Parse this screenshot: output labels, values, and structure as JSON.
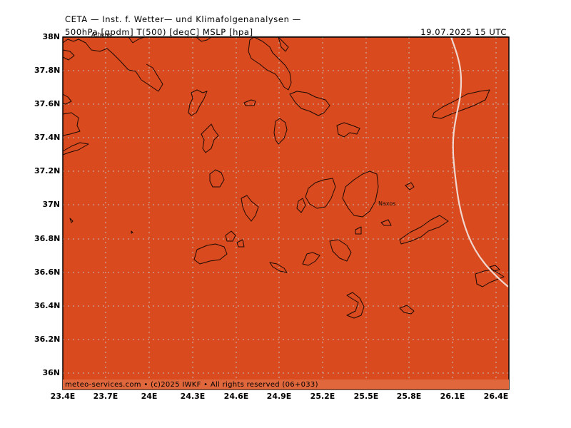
{
  "header": {
    "agency": "CETA — Inst. f. Wetter— und Klimafolgenanalysen —",
    "params": "500hPa [gpdm] T(500) [degC] MSLP [hpa]",
    "datetime": "19.07.2025 15 UTC"
  },
  "map": {
    "fill_color": "#d94a1e",
    "coast_color": "#1a0a05",
    "isoline_color": "#f0d8d0",
    "grid_color": "#c8a89a",
    "lon_range": [
      23.4,
      26.45
    ],
    "lat_range": [
      35.89,
      37.95
    ],
    "lat_ticks": [
      "38N",
      "37.8N",
      "37.6N",
      "37.4N",
      "37.2N",
      "37N",
      "36.8N",
      "36.6N",
      "36.4N",
      "36.2N",
      "36N"
    ],
    "lon_ticks": [
      "23.4E",
      "23.7E",
      "24E",
      "24.3E",
      "24.6E",
      "24.9E",
      "25.2E",
      "25.5E",
      "25.8E",
      "26.1E",
      "26.4E"
    ],
    "labels": {
      "naxos": "Naxos",
      "athens": "Athens"
    }
  },
  "footer": {
    "copyright": "meteo-services.com • (c)2025 IWKF • All rights reserved (06+033)"
  }
}
